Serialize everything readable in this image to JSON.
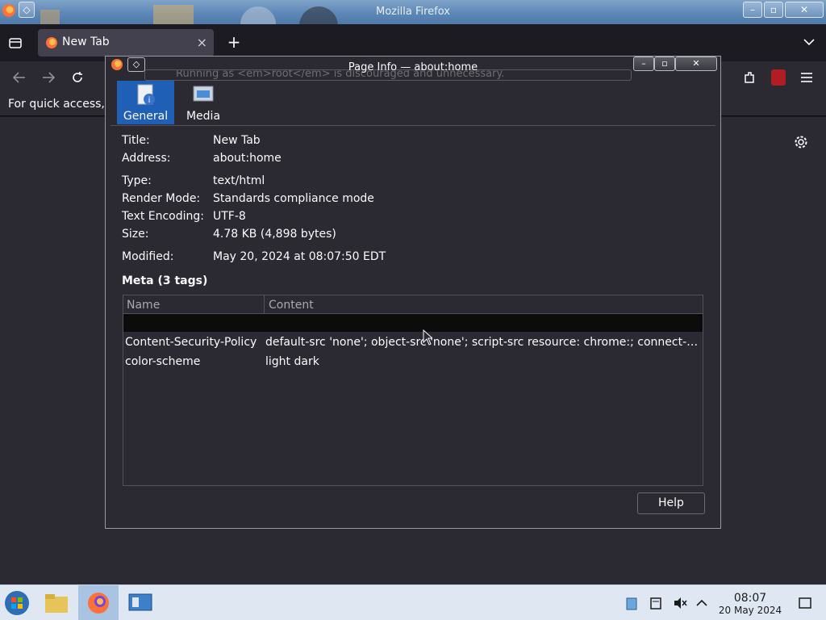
{
  "os_window": {
    "title": "Mozilla Firefox",
    "buttons": [
      "–",
      "▫",
      "✕"
    ]
  },
  "browser": {
    "tab": {
      "label": "New Tab",
      "close": "×"
    },
    "new_tab": "+",
    "bookmarks_text": "For quick access, p"
  },
  "dialog": {
    "title": "Page Info — about:home",
    "ghost_text": "Running as <em>root</em> is discouraged and unnecessary.",
    "tabs": [
      {
        "label": "General",
        "selected": true
      },
      {
        "label": "Media",
        "selected": false
      }
    ],
    "fields": [
      {
        "label": "Title:",
        "value": "New Tab"
      },
      {
        "label": "Address:",
        "value": "about:home"
      },
      {
        "label": "Type:",
        "value": "text/html"
      },
      {
        "label": "Render Mode:",
        "value": "Standards compliance mode"
      },
      {
        "label": "Text Encoding:",
        "value": "UTF-8"
      },
      {
        "label": "Size:",
        "value": "4.78 KB (4,898 bytes)"
      },
      {
        "label": "Modified:",
        "value": "May 20, 2024 at 08:07:50 EDT"
      }
    ],
    "meta_heading": "Meta (3 tags)",
    "meta_columns": [
      "Name",
      "Content"
    ],
    "meta_rows": [
      {
        "name": "Content-Security-Policy",
        "content": "default-src 'none'; object-src 'none'; script-src resource: chrome:; connect-src ..."
      },
      {
        "name": "color-scheme",
        "content": "light dark"
      }
    ],
    "help_label": "Help"
  },
  "taskbar": {
    "time": "08:07",
    "date": "20 May 2024"
  },
  "colors": {
    "accent": "#1f5fb5",
    "dark_bg": "#2b2a33",
    "taskbar": "#dfe8f2"
  }
}
